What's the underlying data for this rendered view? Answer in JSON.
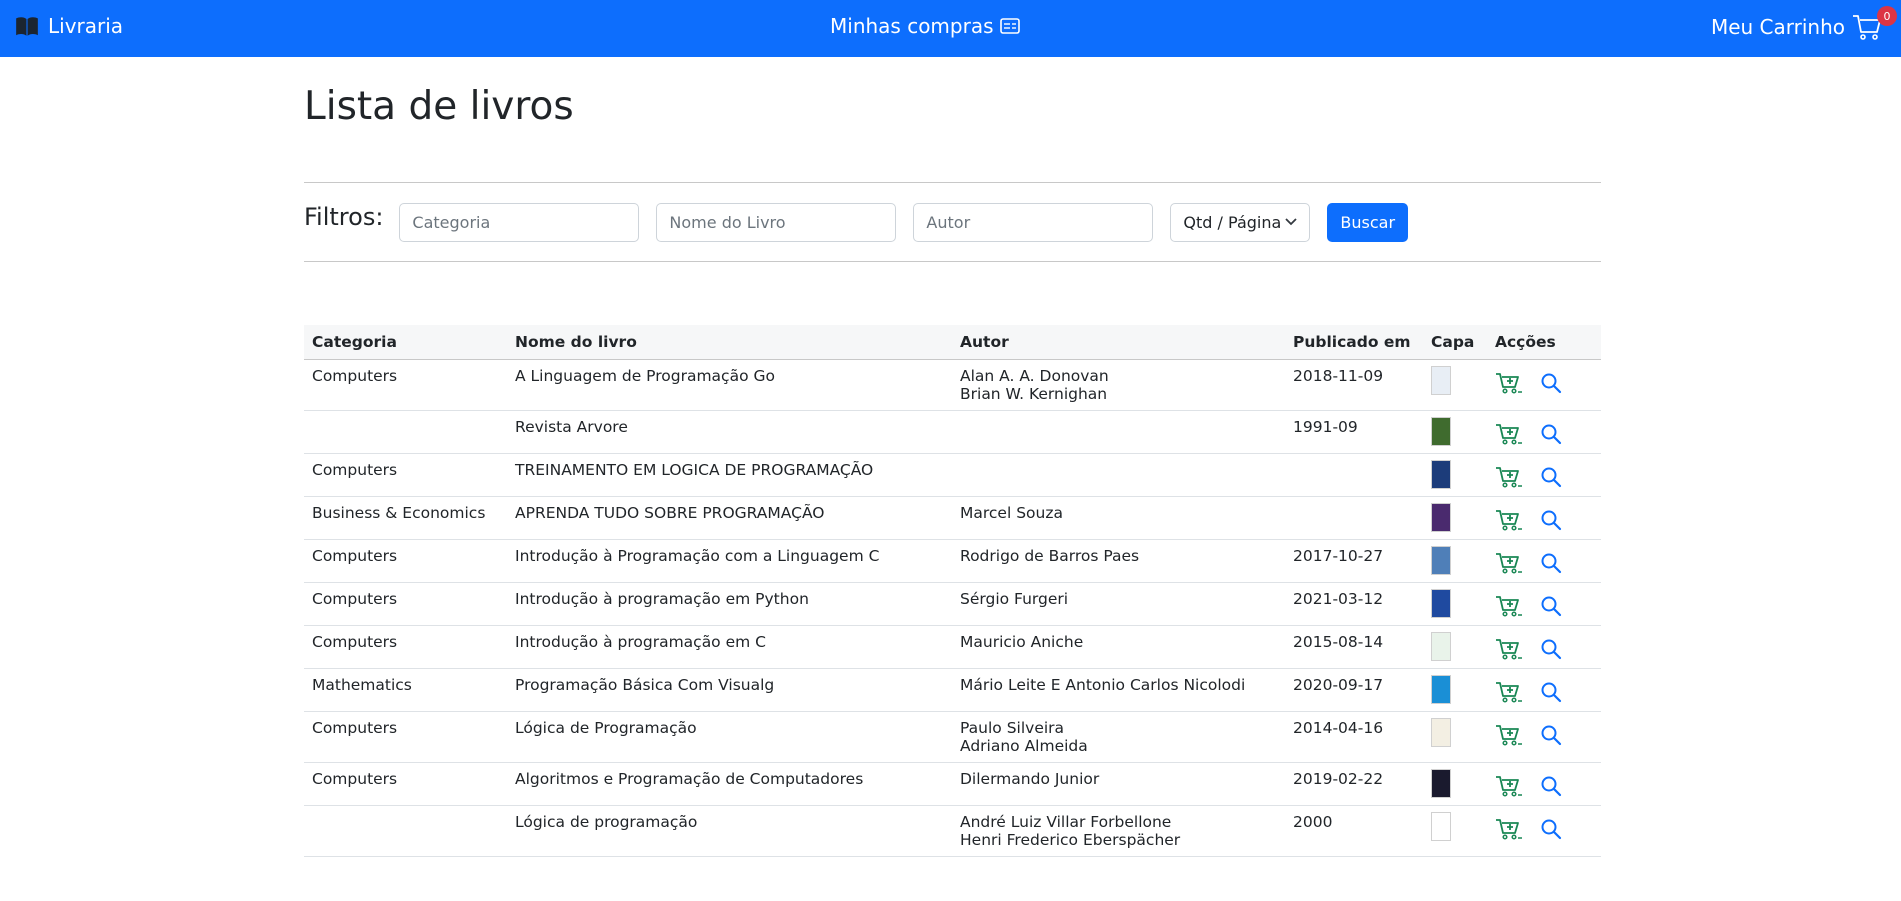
{
  "nav": {
    "brand": "Livraria",
    "orders": "Minhas compras",
    "cart": "Meu Carrinho",
    "cart_count": "0"
  },
  "page": {
    "title": "Lista de livros"
  },
  "filters": {
    "label": "Filtros:",
    "category_placeholder": "Categoria",
    "name_placeholder": "Nome do Livro",
    "author_placeholder": "Autor",
    "per_page_label": "Qtd / Página",
    "search_button": "Buscar"
  },
  "table": {
    "headers": [
      "Categoria",
      "Nome do livro",
      "Autor",
      "Publicado em",
      "Capa",
      "Acções"
    ],
    "rows": [
      {
        "category": "Computers",
        "name": "A Linguagem de Programação Go",
        "author": [
          "Alan A. A. Donovan",
          "Brian W. Kernighan"
        ],
        "published": "2018-11-09",
        "cover_color": "#e8eef5"
      },
      {
        "category": "",
        "name": "Revista Arvore",
        "author": [],
        "published": "1991-09",
        "cover_color": "#3f6b2e"
      },
      {
        "category": "Computers",
        "name": "TREINAMENTO EM LOGICA DE PROGRAMAÇÃO",
        "author": [],
        "published": "",
        "cover_color": "#1c3c7a"
      },
      {
        "category": "Business & Economics",
        "name": "APRENDA TUDO SOBRE PROGRAMAÇÃO",
        "author": [
          "Marcel Souza"
        ],
        "published": "",
        "cover_color": "#4a2a6e"
      },
      {
        "category": "Computers",
        "name": "Introdução à Programação com a Linguagem C",
        "author": [
          "Rodrigo de Barros Paes"
        ],
        "published": "2017-10-27",
        "cover_color": "#4f7fb8"
      },
      {
        "category": "Computers",
        "name": "Introdução à programação em Python",
        "author": [
          "Sérgio Furgeri"
        ],
        "published": "2021-03-12",
        "cover_color": "#1f4aa0"
      },
      {
        "category": "Computers",
        "name": "Introdução à programação em C",
        "author": [
          "Mauricio Aniche"
        ],
        "published": "2015-08-14",
        "cover_color": "#e9f3ea"
      },
      {
        "category": "Mathematics",
        "name": "Programação Básica Com Visualg",
        "author": [
          "Mário Leite E Antonio Carlos Nicolodi"
        ],
        "published": "2020-09-17",
        "cover_color": "#1a8fd6"
      },
      {
        "category": "Computers",
        "name": "Lógica de Programação",
        "author": [
          "Paulo Silveira",
          "Adriano Almeida"
        ],
        "published": "2014-04-16",
        "cover_color": "#f3efe3"
      },
      {
        "category": "Computers",
        "name": "Algoritmos e Programação de Computadores",
        "author": [
          "Dilermando Junior"
        ],
        "published": "2019-02-22",
        "cover_color": "#1a1a2e"
      },
      {
        "category": "",
        "name": "Lógica de programação",
        "author": [
          "André Luiz Villar Forbellone",
          "Henri Frederico Eberspächer"
        ],
        "published": "2000",
        "cover_color": "#ffffff"
      }
    ]
  },
  "colors": {
    "primary": "#0d6efd",
    "cart_action": "#198754",
    "view_action": "#0d6efd",
    "badge": "#dc3545"
  }
}
